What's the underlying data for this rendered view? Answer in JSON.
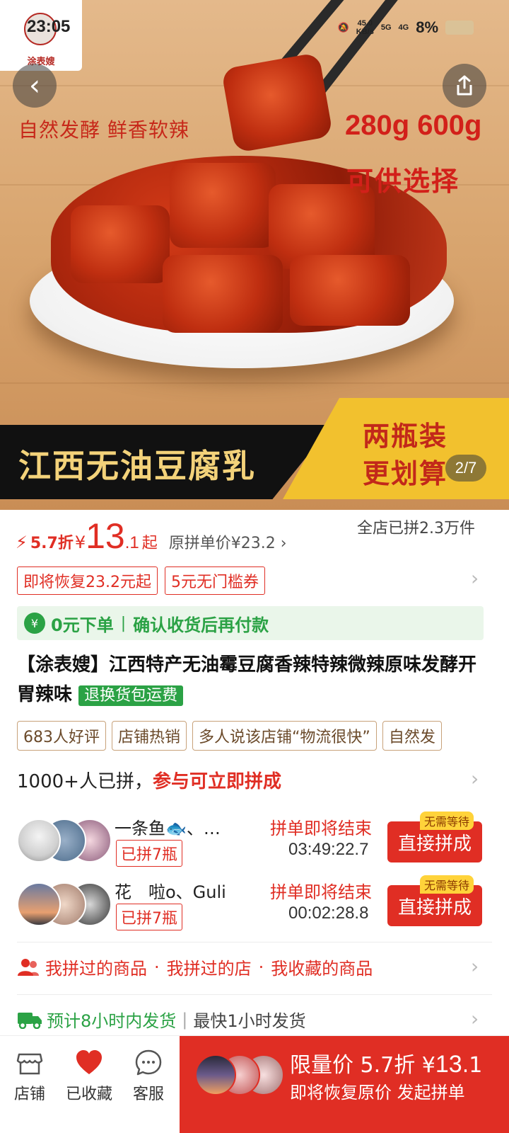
{
  "status_bar": {
    "time": "23:05",
    "net_speed_value": "45.0",
    "net_speed_unit": "KB/s",
    "signal_5g": "5G",
    "signal_4g": "4G",
    "battery": "8%"
  },
  "hero": {
    "shop_logo_text": "涂表嫂",
    "slogan_left": "自然发酵 鲜香软辣",
    "slogan_right_line1": "280g 600g",
    "slogan_right_line2": "可供选择",
    "banner_title": "江西无油豆腐乳",
    "promo_line1": "两瓶装",
    "promo_line2": "更划算",
    "page_indicator": "2/7"
  },
  "price": {
    "bolt_icon": "lightning-icon",
    "discount": "5.7折",
    "currency": "¥",
    "price_int": "13",
    "price_dec": ".1",
    "suffix": "起",
    "original": "原拼单价¥23.2 ›",
    "shop_sold": "全店已拼2.3万件"
  },
  "coupons": [
    "即将恢复23.2元起",
    "5元无门槛券"
  ],
  "pay_later": {
    "badge_symbol": "¥",
    "left": "0元下单",
    "separator": "|",
    "right": "确认收货后再付款"
  },
  "product": {
    "title": "【涂表嫂】江西特产无油霉豆腐香辣特辣微辣原味发酵开胃辣味",
    "green_tag": "退换货包运费"
  },
  "tags": [
    "683人好评",
    "店铺热销",
    "多人说该店铺“物流很快”",
    "自然发"
  ],
  "group_buy": {
    "count_text": "1000+人已拼，",
    "join_text": "参与可立即拼成",
    "items": [
      {
        "name": "一条鱼🐟、…",
        "badge": "已拼7瓶",
        "ending": "拼单即将结束",
        "timer": "03:49:22.7",
        "button": "直接拼成",
        "no_wait": "无需等待"
      },
      {
        "name": "花　啦o、Guli",
        "badge": "已拼7瓶",
        "ending": "拼单即将结束",
        "timer": "00:02:28.8",
        "button": "直接拼成",
        "no_wait": "无需等待"
      }
    ]
  },
  "history": {
    "item1": "我拼过的商品",
    "item2": "我拼过的店",
    "item3": "我收藏的商品",
    "dot": "·"
  },
  "shipping": {
    "estimate": "预计8小时内发货",
    "separator": "|",
    "fastest": "最快1小时发货"
  },
  "bottom_bar": {
    "tab_store": "店铺",
    "tab_favorited": "已收藏",
    "tab_service": "客服",
    "buy_line1_prefix": "限量价 5.7折 ¥",
    "buy_price_int": "13",
    "buy_price_dec": ".1",
    "buy_line2": "即将恢复原价 发起拼单"
  },
  "colors": {
    "accent_red": "#e02e24",
    "green": "#2ba245"
  }
}
